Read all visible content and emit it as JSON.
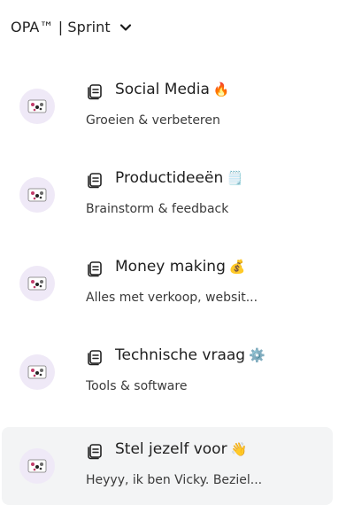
{
  "header": {
    "title": "OPA™ | Sprint"
  },
  "channels": [
    {
      "title": "Social Media",
      "emoji": "🔥",
      "subtitle": "Groeien & verbeteren",
      "selected": false
    },
    {
      "title": "Productideeën",
      "emoji": "🗒️",
      "subtitle": "Brainstorm & feedback",
      "selected": false
    },
    {
      "title": "Money making",
      "emoji": "💰",
      "subtitle": "Alles met verkoop, websit...",
      "selected": false
    },
    {
      "title": "Technische vraag",
      "emoji": "⚙️",
      "subtitle": "Tools & software",
      "selected": false
    },
    {
      "title": "Stel jezelf voor",
      "emoji": "👋",
      "subtitle": "Heyyy, ik ben Vicky. Beziel...",
      "selected": true
    }
  ],
  "colors": {
    "selected_background": "#f3f4f5",
    "avatar_background": "#efe9f7",
    "text": "#1f1f1f",
    "subtext": "#3a3a3a"
  }
}
